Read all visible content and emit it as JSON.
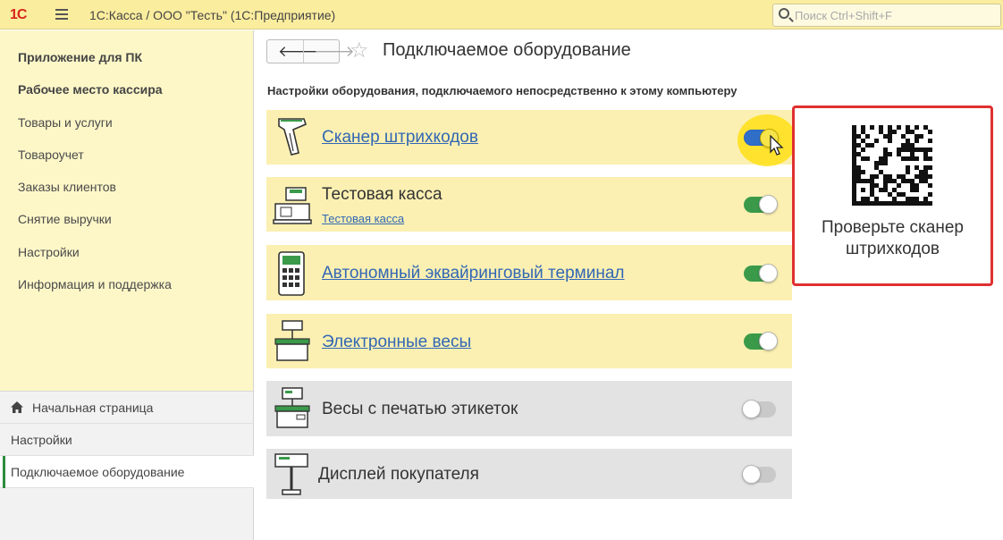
{
  "titlebar": {
    "logo": "1С",
    "title": "1С:Касса / ООО \"Тесть\"  (1С:Предприятие)",
    "search_placeholder": "Поиск Ctrl+Shift+F"
  },
  "sidebar": {
    "items": [
      {
        "label": "Приложение для ПК",
        "bold": true
      },
      {
        "label": "Рабочее место кассира",
        "bold": true
      },
      {
        "label": "Товары и услуги",
        "bold": false
      },
      {
        "label": "Товароучет",
        "bold": false
      },
      {
        "label": "Заказы клиентов",
        "bold": false
      },
      {
        "label": "Снятие выручки",
        "bold": false
      },
      {
        "label": "Настройки",
        "bold": false
      },
      {
        "label": "Информация и поддержка",
        "bold": false
      }
    ]
  },
  "open_windows": [
    {
      "label": "Начальная страница",
      "icon": "home-icon"
    },
    {
      "label": "Настройки"
    },
    {
      "label": "Подключаемое оборудование",
      "active": true
    }
  ],
  "main": {
    "back_glyph": "🡐",
    "forward_glyph": "🡒",
    "star_glyph": "☆",
    "title": "Подключаемое оборудование",
    "subheading": "Настройки оборудования, подключаемого непосредственно к этому компьютеру"
  },
  "devices": [
    {
      "label": "Сканер штрихкодов",
      "link": true,
      "enabled": true,
      "icon": "barcode-scanner-icon"
    },
    {
      "label": "Тестовая касса",
      "link": false,
      "sublink": "Тестовая касса",
      "enabled": true,
      "icon": "cash-register-icon"
    },
    {
      "label": "Автономный эквайринговый терминал",
      "link": true,
      "enabled": true,
      "icon": "payment-terminal-icon"
    },
    {
      "label": "Электронные весы",
      "link": true,
      "enabled": true,
      "icon": "scales-icon"
    },
    {
      "label": "Весы с печатью этикеток",
      "link": false,
      "enabled": false,
      "icon": "label-scales-icon"
    },
    {
      "label": "Дисплей покупателя",
      "link": false,
      "enabled": false,
      "icon": "customer-display-icon"
    }
  ],
  "callout": {
    "text": "Проверьте сканер штрихкодов",
    "icon": "datamatrix-code-icon",
    "border_color": "#e03030"
  },
  "colors": {
    "titlebar": "#fbed9e",
    "sidebar": "#fdf7c8",
    "row_enabled": "#fbf0b2",
    "row_disabled": "#e3e3e3",
    "toggle_on": "#3a9a4a",
    "link": "#3267b4"
  }
}
